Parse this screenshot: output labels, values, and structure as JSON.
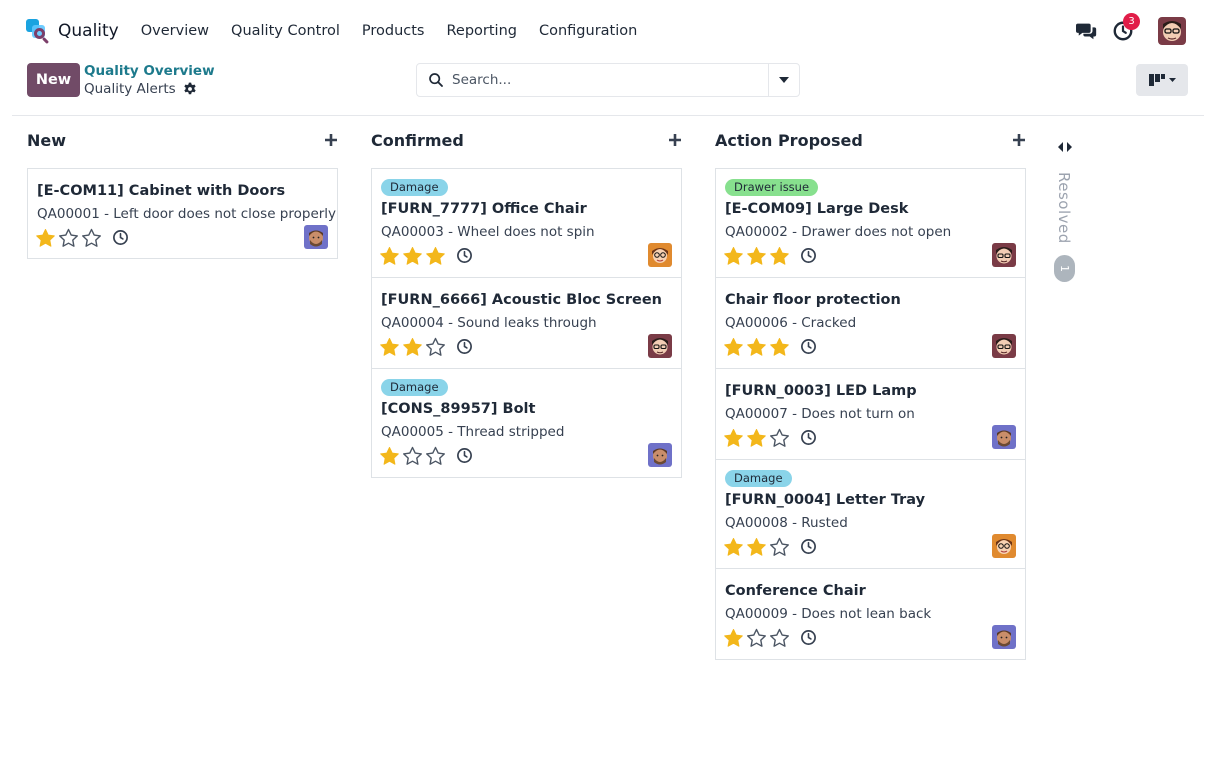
{
  "navbar": {
    "app_name": "Quality",
    "menu": [
      "Overview",
      "Quality Control",
      "Products",
      "Reporting",
      "Configuration"
    ],
    "activity_count": "3"
  },
  "control_panel": {
    "new_label": "New",
    "breadcrumb_parent": "Quality Overview",
    "breadcrumb_current": "Quality Alerts",
    "search_placeholder": "Search..."
  },
  "colors": {
    "brand": "#714b67",
    "star_on": "#f3b71b",
    "tag_damage": "#8ad4e9",
    "tag_drawer": "#87e08e"
  },
  "columns": [
    {
      "title": "New",
      "cards": [
        {
          "title": "[E-COM11] Cabinet with Doors",
          "subtitle": "QA00001 - Left door does not close properly",
          "stars": 1,
          "avatar": "man"
        }
      ]
    },
    {
      "title": "Confirmed",
      "cards": [
        {
          "tag": "Damage",
          "tag_color": "#8ad4e9",
          "title": "[FURN_7777] Office Chair",
          "subtitle": "QA00003 - Wheel does not spin",
          "stars": 3,
          "avatar": "woman"
        },
        {
          "title": "[FURN_6666] Acoustic Bloc Screen",
          "subtitle": "QA00004 - Sound leaks through",
          "stars": 2,
          "avatar": "glasses"
        },
        {
          "tag": "Damage",
          "tag_color": "#8ad4e9",
          "title": "[CONS_89957] Bolt",
          "subtitle": "QA00005 - Thread stripped",
          "stars": 1,
          "avatar": "man"
        }
      ]
    },
    {
      "title": "Action Proposed",
      "cards": [
        {
          "tag": "Drawer issue",
          "tag_color": "#87e08e",
          "title": "[E-COM09] Large Desk",
          "subtitle": "QA00002 - Drawer does not open",
          "stars": 3,
          "avatar": "glasses"
        },
        {
          "title": "Chair floor protection",
          "subtitle": "QA00006 - Cracked",
          "stars": 3,
          "avatar": "glasses"
        },
        {
          "title": "[FURN_0003] LED Lamp",
          "subtitle": "QA00007 - Does not turn on",
          "stars": 2,
          "avatar": "man"
        },
        {
          "tag": "Damage",
          "tag_color": "#8ad4e9",
          "title": "[FURN_0004] Letter Tray",
          "subtitle": "QA00008 - Rusted",
          "stars": 2,
          "avatar": "woman"
        },
        {
          "title": "Conference Chair",
          "subtitle": "QA00009 - Does not lean back",
          "stars": 1,
          "avatar": "man"
        }
      ]
    }
  ],
  "folded_column": {
    "title": "Resolved",
    "count": "1"
  }
}
